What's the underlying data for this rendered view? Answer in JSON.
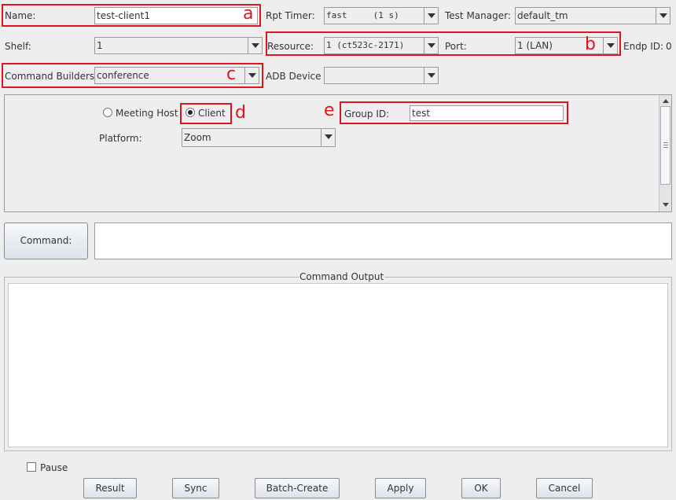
{
  "row1": {
    "name_label": "Name:",
    "name_value": "test-client1",
    "rpt_timer_label": "Rpt Timer:",
    "rpt_timer_value": "fast     (1 s)",
    "test_manager_label": "Test Manager:",
    "test_manager_value": "default_tm"
  },
  "row2": {
    "shelf_label": "Shelf:",
    "shelf_value": "1",
    "resource_label": "Resource:",
    "resource_value": "1 (ct523c-2171)",
    "port_label": "Port:",
    "port_value": "1 (LAN)",
    "endp_id_label": "Endp ID:",
    "endp_id_value": "0"
  },
  "row3": {
    "command_builders_label": "Command Builders",
    "command_builders_value": "conference",
    "adb_device_label": "ADB Device",
    "adb_device_value": ""
  },
  "config": {
    "meeting_host_label": "Meeting Host",
    "client_label": "Client",
    "group_id_label": "Group ID:",
    "group_id_value": "test",
    "platform_label": "Platform:",
    "platform_value": "Zoom"
  },
  "command": {
    "button_label": "Command:",
    "value": ""
  },
  "output": {
    "title": "Command Output"
  },
  "pause_label": "Pause",
  "buttons": {
    "result": "Result",
    "sync": "Sync",
    "batch_create": "Batch-Create",
    "apply": "Apply",
    "ok": "OK",
    "cancel": "Cancel"
  },
  "annotations": {
    "a": "a",
    "b": "b",
    "c": "c",
    "d": "d",
    "e": "e"
  },
  "colors": {
    "annotation": "#e0141e"
  }
}
